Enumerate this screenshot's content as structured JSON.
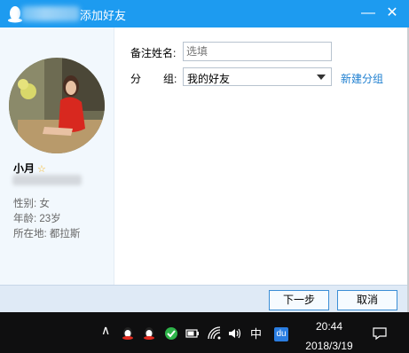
{
  "window": {
    "title": "添加好友",
    "min_icon": "minimize-icon",
    "close_icon": "close-icon"
  },
  "profile": {
    "name": "小月",
    "gender": "性别: 女",
    "age": "年龄: 23岁",
    "location": "所在地:  都拉斯"
  },
  "form": {
    "remark_label": "备注姓名:",
    "remark_placeholder": "选填",
    "group_label_1": "分",
    "group_label_2": "组:",
    "group_value": "我的好友",
    "new_group_link": "新建分组"
  },
  "footer": {
    "next_label": "下一步",
    "cancel_label": "取消"
  },
  "taskbar": {
    "ime": "中",
    "baidu": "du",
    "time": "20:44",
    "date": "2018/3/19"
  },
  "colors": {
    "titlebar": "#1d9bf0",
    "link": "#1e7fd0",
    "taskbar": "#0f0f10"
  }
}
